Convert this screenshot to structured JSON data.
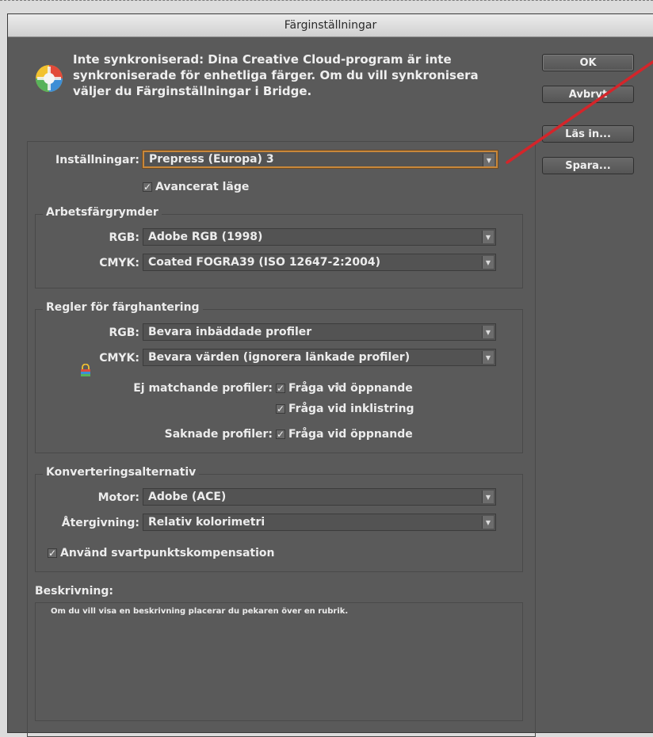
{
  "dialog": {
    "title": "Färginställningar",
    "notice": "Inte synkroniserad: Dina Creative Cloud-program är inte synkroniserade för enhetliga färger. Om du vill synkronisera väljer du Färginställningar i Bridge."
  },
  "buttons": {
    "ok": "OK",
    "cancel": "Avbryt",
    "load": "Läs in...",
    "save": "Spara..."
  },
  "settings": {
    "label": "Inställningar:",
    "value": "Prepress (Europa) 3",
    "advanced_mode": "Avancerat läge",
    "advanced_checked": true
  },
  "working_spaces": {
    "title": "Arbetsfärgrymder",
    "rgb_label": "RGB:",
    "rgb_value": "Adobe RGB (1998)",
    "cmyk_label": "CMYK:",
    "cmyk_value": "Coated FOGRA39 (ISO 12647-2:2004)"
  },
  "color_management": {
    "title": "Regler för färghantering",
    "rgb_label": "RGB:",
    "rgb_value": "Bevara inbäddade profiler",
    "cmyk_label": "CMYK:",
    "cmyk_value": "Bevara värden (ignorera länkade profiler)",
    "mismatch_label": "Ej matchande profiler:",
    "ask_on_open": "Fråga vid öppnande",
    "ask_on_paste": "Fråga vid inklistring",
    "missing_label": "Saknade profiler:",
    "missing_ask_on_open": "Fråga vid öppnande"
  },
  "conversion": {
    "title": "Konverteringsalternativ",
    "engine_label": "Motor:",
    "engine_value": "Adobe (ACE)",
    "intent_label": "Återgivning:",
    "intent_value": "Relativ kolorimetri",
    "black_point": "Använd svartpunktskompensation"
  },
  "description": {
    "title": "Beskrivning:",
    "text": "Om du vill visa en beskrivning placerar du pekaren över en rubrik."
  },
  "icons": {
    "sync": "color-wheel-icon",
    "lock": "lock-icon",
    "cursor": "crosshair-cursor-icon",
    "dropdown": "chevron-down-icon",
    "check": "checkmark-icon"
  },
  "colors": {
    "dialog_bg": "#5a5a5a",
    "focus_ring": "#c8873a",
    "annotation_line": "#d4252a"
  }
}
